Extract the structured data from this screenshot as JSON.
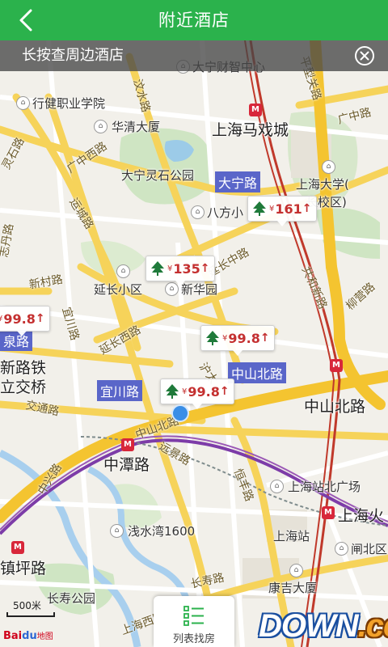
{
  "header": {
    "title": "附近酒店"
  },
  "banner": {
    "text": "长按查周边酒店"
  },
  "labels": {
    "dani_caizhi": "大宁财智中心",
    "xingjian": "行健职业学院",
    "huaqing": "华清大厦",
    "majicheng": "上海马戏城",
    "daning_park": "大宁灵石公园",
    "shu_univ": "上海大学(",
    "changxiaoqu": "长校区)",
    "bafang": "八方小",
    "yanchang_xiaoqu": "延长小区",
    "xinhuayuan": "新华园",
    "zhongshan_bei_right": "中山北路",
    "zhongtanlu": "中潭路",
    "station_north_sq": "上海站北广场",
    "shanghai_huo": "上海火",
    "shanghai_zhan": "上海站",
    "qianwan": "浅水湾1600",
    "zhabei": "闸北区",
    "kangji": "康吉大厦",
    "zhenpinglu": "镇坪路",
    "changshou_park": "长寿公园"
  },
  "roads": {
    "pingxing": "平型关路",
    "guangzhong": "广中路",
    "lingshi": "灵石路",
    "guangzhong_west": "广中西路",
    "wenshui": "汶水路",
    "yuncheng": "运城路",
    "zhidan": "志丹路",
    "xincun": "新村路",
    "yichuan_v": "宜川路",
    "yanchang_west": "延长西路",
    "yanchang_mid": "延长中路",
    "gonghe": "共和新路",
    "liuying": "柳营路",
    "hutai": "沪太",
    "jiaotong": "交通路",
    "zhongshan_bei": "中山北路",
    "yunchang": "远景路",
    "hengfeng": "恒丰路",
    "changshou": "长寿路",
    "shanghai_xi": "上海西路",
    "zhongxing": "中兴路"
  },
  "blue_labels": {
    "daning_road": "大宁路",
    "zhongshan_north": "中山北路",
    "yichuan": "宜川路",
    "yuanquan": "泉路",
    "xinlutie": "新路铁",
    "lijiaoqiao": "立交桥"
  },
  "hotels": [
    {
      "price": "161",
      "currency": "¥",
      "trend": "↑"
    },
    {
      "price": "135",
      "currency": "¥",
      "trend": "↑"
    },
    {
      "price": "99.8",
      "currency": "¥",
      "trend": "↑"
    },
    {
      "price": "99.8",
      "currency": "¥",
      "trend": "↑"
    },
    {
      "price": "99.8",
      "currency": "¥",
      "trend": "↑"
    }
  ],
  "scale": {
    "label": "500米"
  },
  "logo": {
    "brand": "Bai",
    "brand2": "du",
    "suffix": "地图"
  },
  "list_button": {
    "label": "列表找房"
  },
  "watermark": {
    "main": "DOWN",
    "dot": ".",
    "tld": "cc"
  },
  "colors": {
    "header": "#2bb24c",
    "price": "#c43030",
    "metro_red": "#d8273a",
    "road_yellow": "#f6d35a"
  }
}
